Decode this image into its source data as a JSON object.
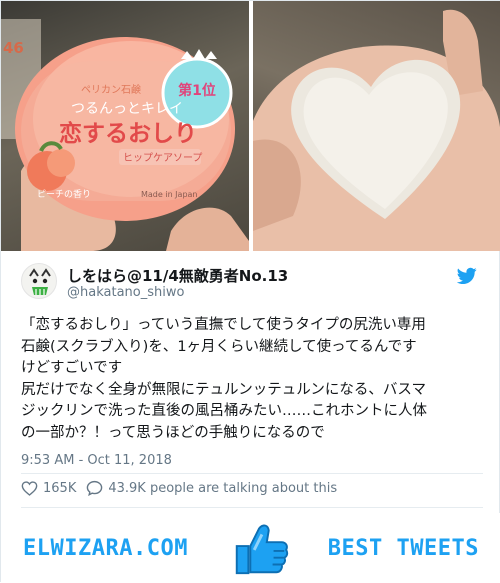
{
  "photos": {
    "left": {
      "icon": "soap-package-photo",
      "package_brand_small": "ペリカン石鹸",
      "package_line1": "つるんっとキレイ",
      "package_title": "恋するおしり",
      "package_subtitle": "ヒップケアソープ",
      "package_scent": "ピーチの香り",
      "package_badge": "第1位",
      "package_origin": "Made in Japan"
    },
    "right": {
      "icon": "heart-shaped-soap-photo"
    }
  },
  "tweet": {
    "display_name": "しをはら@11/4無敵勇者No.13",
    "handle": "@hakatano_shiwo",
    "lines": [
      "「恋するおしり」っていう直撫でして使うタイプの尻洗い専用",
      "石鹸(スクラブ入り)を、1ヶ月くらい継続して使ってるんです",
      "けどすごいです",
      "尻だけでなく全身が無限にテュルンッテュルンになる、バスマ",
      "ジックリンで洗った直後の風呂桶みたい……これホントに人体",
      "の一部か？！って思うほどの手触りになるので"
    ],
    "timestamp": "9:53 AM - Oct 11, 2018",
    "likes": "165K",
    "talking": "43.9K people are talking about this"
  },
  "footer": {
    "site": "ELWIZARA.COM",
    "tagline": "BEST TWEETS"
  },
  "colors": {
    "twitter_blue": "#1da1f2",
    "text": "#14171a",
    "muted": "#657786",
    "border": "#e6ecf0"
  },
  "icons": {
    "brand": "twitter-bird-icon",
    "like": "heart-outline-icon",
    "reply": "speech-bubble-icon",
    "footer": "thumbs-up-icon"
  }
}
